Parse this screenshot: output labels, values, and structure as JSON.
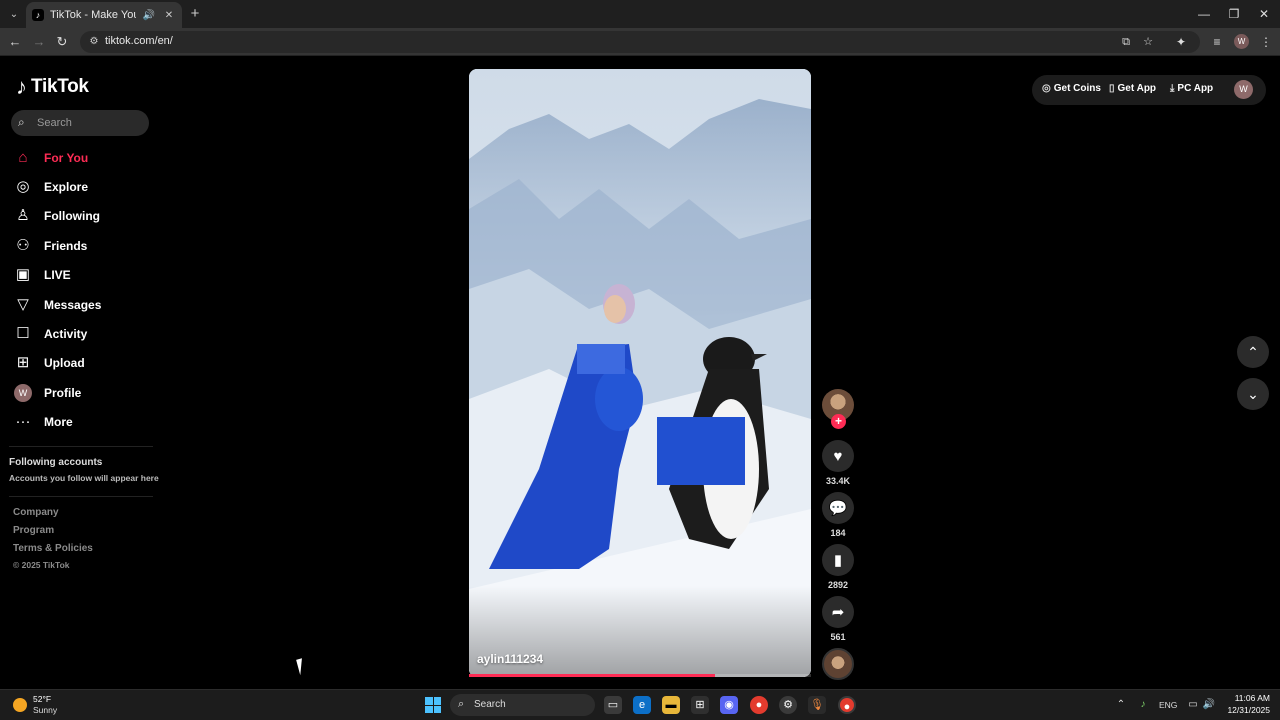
{
  "browser": {
    "tab_title": "TikTok - Make Your Day",
    "url": "tiktok.com/en/",
    "profile_initial": "W"
  },
  "sidebar": {
    "logo_text": "TikTok",
    "search_placeholder": "Search",
    "items": [
      {
        "label": "For You",
        "icon": "home-icon",
        "active": true
      },
      {
        "label": "Explore",
        "icon": "compass-icon"
      },
      {
        "label": "Following",
        "icon": "following-icon"
      },
      {
        "label": "Friends",
        "icon": "friends-icon"
      },
      {
        "label": "LIVE",
        "icon": "live-icon"
      },
      {
        "label": "Messages",
        "icon": "messages-icon"
      },
      {
        "label": "Activity",
        "icon": "activity-icon"
      },
      {
        "label": "Upload",
        "icon": "upload-icon"
      },
      {
        "label": "Profile",
        "icon": "avatar",
        "avatar_initial": "W"
      },
      {
        "label": "More",
        "icon": "more-icon"
      }
    ],
    "following_title": "Following accounts",
    "following_subtitle": "Accounts you follow will appear here",
    "footer_links": [
      "Company",
      "Program",
      "Terms & Policies"
    ],
    "copyright": "© 2025 TikTok"
  },
  "video": {
    "author": "aylin111234",
    "progress_fraction": 0.72,
    "likes": "33.4K",
    "comments": "184",
    "bookmarks": "2892",
    "shares": "561"
  },
  "topbar": {
    "get_coins": "Get Coins",
    "get_app": "Get App",
    "pc_app": "PC App",
    "avatar_initial": "W"
  },
  "taskbar": {
    "weather_temp": "52°F",
    "weather_cond": "Sunny",
    "search_label": "Search",
    "lang": "ENG",
    "time": "11:06 AM",
    "date": "12/31/2025"
  },
  "colors": {
    "accent": "#fe2c55",
    "background": "#000000"
  }
}
